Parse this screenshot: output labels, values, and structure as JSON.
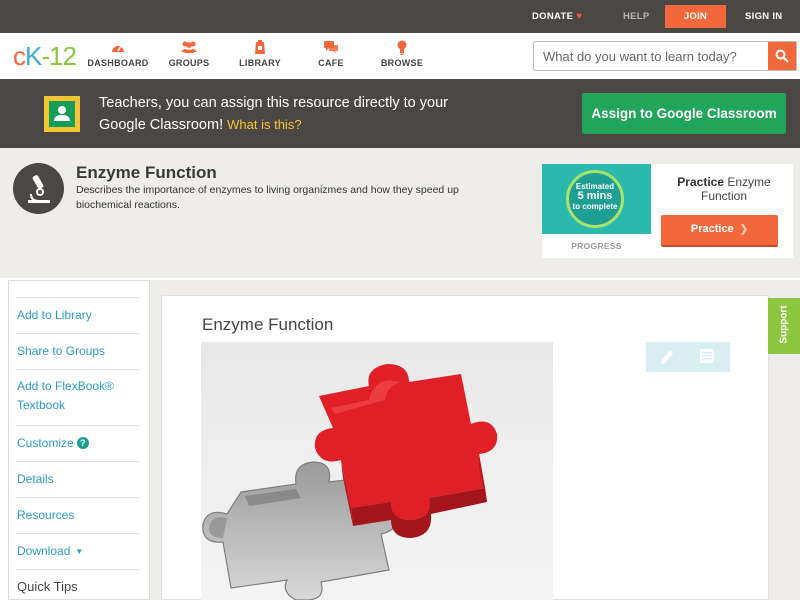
{
  "topbar": {
    "donate": "DONATE",
    "help": "HELP",
    "join": "JOIN",
    "signin": "SIGN IN"
  },
  "nav": {
    "logo": {
      "c": "c",
      "k": "K",
      "dash": "-",
      "n": "12"
    },
    "items": [
      {
        "label": "DASHBOARD",
        "icon": "dashboard-icon"
      },
      {
        "label": "GROUPS",
        "icon": "groups-icon"
      },
      {
        "label": "LIBRARY",
        "icon": "library-icon"
      },
      {
        "label": "CAFE",
        "icon": "cafe-icon"
      },
      {
        "label": "BROWSE",
        "icon": "browse-icon"
      }
    ],
    "search_placeholder": "What do you want to learn today?"
  },
  "banner": {
    "text": "Teachers, you can assign this resource directly to your Google Classroom!",
    "link": "What is this?",
    "button": "Assign to Google Classroom"
  },
  "concept": {
    "title": "Enzyme Function",
    "description": "Describes the importance of enzymes to living organizmes and how they speed up biochemical reactions."
  },
  "practice": {
    "estimated": "Estimated",
    "mins": "5 mins",
    "to_complete": "to complete",
    "progress": "PROGRESS",
    "title_bold": "Practice",
    "title_rest": "Enzyme Function",
    "button": "Practice"
  },
  "sidebar": {
    "items": [
      {
        "label": "Add to Library"
      },
      {
        "label": "Share to Groups"
      },
      {
        "label": "Add to FlexBook® Textbook"
      },
      {
        "label": "Customize"
      },
      {
        "label": "Details"
      },
      {
        "label": "Resources"
      },
      {
        "label": "Download"
      },
      {
        "label": "Quick Tips"
      }
    ],
    "help_mark": "?"
  },
  "main": {
    "title": "Enzyme Function"
  },
  "support": "Support",
  "colors": {
    "orange": "#f2683a",
    "dark": "#4a4744",
    "green": "#20a55a",
    "blue_link": "#2b9bc8",
    "teal": "#1e9f93",
    "lime": "#8cc63f"
  }
}
